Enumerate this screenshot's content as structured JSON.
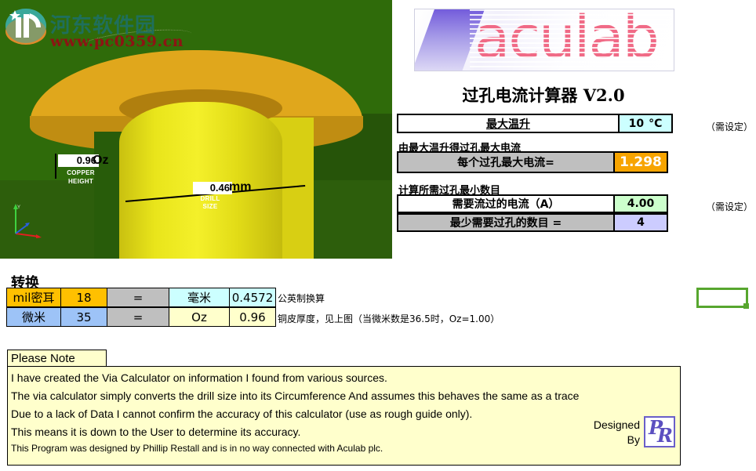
{
  "watermark": {
    "site_name": "河东软件园",
    "url": "www.pc0359.cn"
  },
  "diagram": {
    "copper_height_value": "0.96",
    "copper_height_unit": "Oz",
    "copper_height_label_1": "COPPER",
    "copper_height_label_2": "HEIGHT",
    "drill_size_value": "0.46",
    "drill_size_unit": "mm",
    "drill_size_label_1": "DRILL",
    "drill_size_label_2": "SIZE"
  },
  "header": {
    "logo_text": "aculab",
    "title": "过孔电流计算器 V2.0"
  },
  "calculator": {
    "temp_rise": {
      "label": "最大温升",
      "value": "10",
      "unit": "°C",
      "note": "（需设定）"
    },
    "section_max_current": "由最大温升得过孔最大电流",
    "max_current": {
      "label": "每个过孔最大电流=",
      "value": "1.298"
    },
    "section_min_vias": "计算所需过孔最小数目",
    "required_current": {
      "label": "需要流过的电流（A）",
      "value": "4.00",
      "note": "（需设定）"
    },
    "min_vias": {
      "label": "最少需要过孔的数目 =",
      "value": "4"
    }
  },
  "conversion": {
    "title": "转换",
    "rows": [
      {
        "unit_from": "mil密耳",
        "value_from": "18",
        "equals": "=",
        "unit_to": "毫米",
        "value_to": "0.4572",
        "note": "公英制换算"
      },
      {
        "unit_from": "微米",
        "value_from": "35",
        "equals": "=",
        "unit_to": "Oz",
        "value_to": "0.96",
        "note": "铜皮厚度，见上图（当微米数是36.5时，Oz=1.00）"
      }
    ]
  },
  "note": {
    "tab_label": "Please Note",
    "lines": [
      "I have created the Via Calculator on information I found from various sources.",
      "The via calculator simply converts the drill size into its  Circumference And assumes this behaves the same as a trace",
      "Due to a lack of Data I cannot confirm the accuracy of this calculator (use as rough guide only).",
      "This means it is down to the User to determine its accuracy."
    ],
    "footer": "This Program was designed by Phillip Restall and is in no way connected with Aculab plc.",
    "designed_line1": "Designed",
    "designed_line2": "By",
    "designer_initials": "PR"
  },
  "colors": {
    "temp_value_bg": "#ccffff",
    "max_current_bg": "#f7a400",
    "required_current_bg": "#ccffcc",
    "min_vias_bg": "#ccccff",
    "note_bg": "#ffffcc",
    "selection_border": "#57a62e",
    "logo_pink": "#f06a86"
  }
}
